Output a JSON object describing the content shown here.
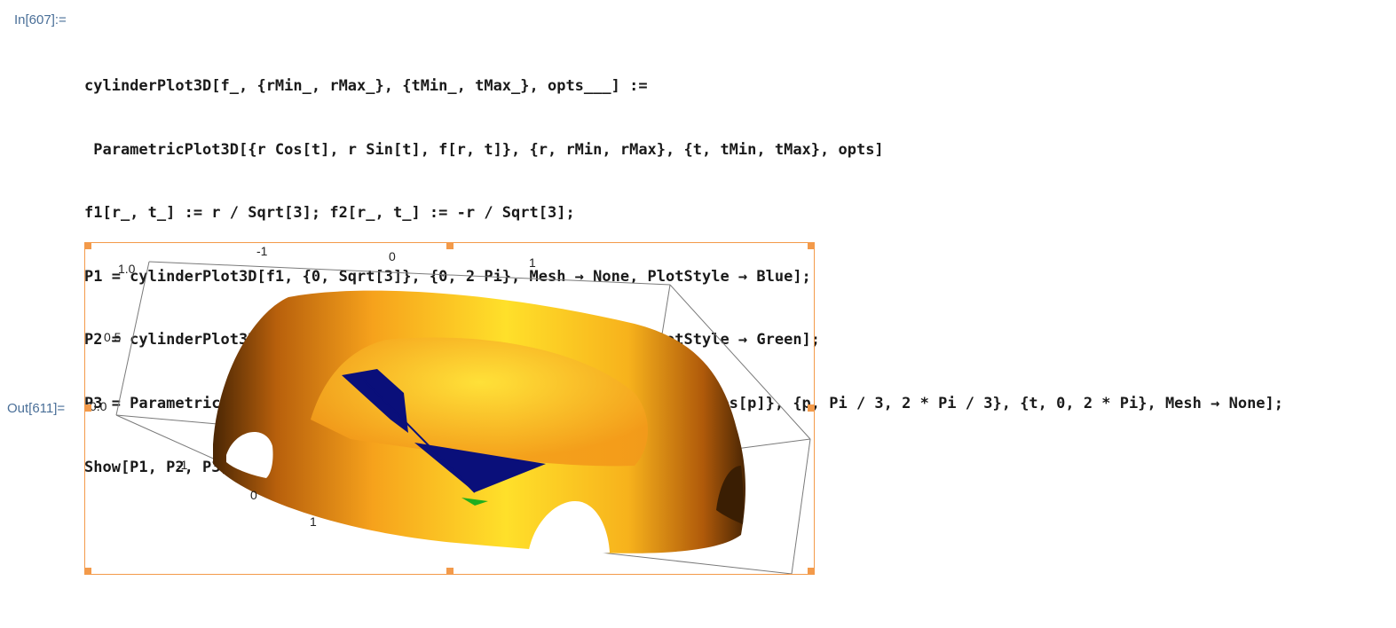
{
  "notebook": {
    "input_label": "In[607]:=",
    "output_label": "Out[611]=",
    "code_lines": [
      "cylinderPlot3D[f_, {rMin_, rMax_}, {tMin_, tMax_}, opts___] :=",
      " ParametricPlot3D[{r Cos[t], r Sin[t], f[r, t]}, {r, rMin, rMax}, {t, tMin, tMax}, opts]",
      "f1[r_, t_] := r / Sqrt[3]; f2[r_, t_] := -r / Sqrt[3];",
      "P1 = cylinderPlot3D[f1, {0, Sqrt[3]}, {0, 2 Pi}, Mesh → None, PlotStyle → Blue];",
      "P2 = cylinderPlot3D[f2, {0, Sqrt[3]}, {0, 2 Pi}, Mesh → None, PlotStyle → Green];",
      "P3 = ParametricPlot3D[{2 * Sin[p] * Cos[t], 2 * Sin[p] * Sin[t], 2 * Cos[p]}, {p, Pi / 3, 2 * Pi / 3}, {t, 0, 2 * Pi}, Mesh → None];",
      "Show[P1, P2, P3]"
    ]
  },
  "plot": {
    "top_ticks": [
      "-1",
      "0",
      "1"
    ],
    "z_ticks": [
      "1.0",
      "0.5",
      "0.0"
    ],
    "front_ticks": [
      "-1",
      "0",
      "1"
    ],
    "colors": {
      "band_light": "#ffd21a",
      "band_mid": "#f7a21a",
      "band_dark": "#5a2e05",
      "cone_blue": "#0a0f7a",
      "cone_green": "#1fae1f",
      "frame_handle": "#f39a4a",
      "label_blue": "#4a6f98"
    }
  }
}
